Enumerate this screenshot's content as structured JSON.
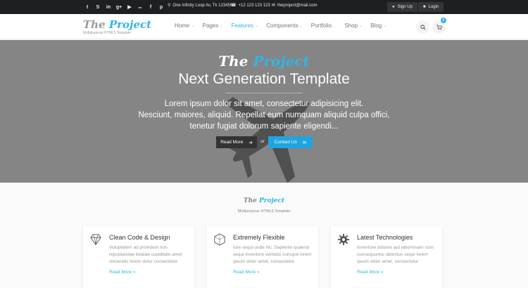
{
  "topbar": {
    "social_icons": [
      {
        "name": "twitter-icon",
        "glyph": "t"
      },
      {
        "name": "skype-icon",
        "glyph": "S"
      },
      {
        "name": "linkedin-icon",
        "glyph": "in"
      },
      {
        "name": "google-plus-icon",
        "glyph": "g+"
      },
      {
        "name": "youtube-icon",
        "glyph": "▶"
      },
      {
        "name": "flickr-icon",
        "glyph": "●●"
      },
      {
        "name": "facebook-icon",
        "glyph": "f"
      },
      {
        "name": "pinterest-icon",
        "glyph": "p"
      }
    ],
    "address": "One Infinity Loop Av, Tk 123456",
    "phone": "+12 123 123 123",
    "email": "theproject@mail.com",
    "signup_label": "Sign Up",
    "login_label": "Login"
  },
  "header": {
    "logo_the": "The",
    "logo_project": "Project",
    "tagline": "Multipurpose HTML5 Template",
    "nav": [
      {
        "label": "Home",
        "active": false
      },
      {
        "label": "Pages",
        "active": false
      },
      {
        "label": "Features",
        "active": true
      },
      {
        "label": "Components",
        "active": false
      },
      {
        "label": "Portfolio",
        "active": false
      },
      {
        "label": "Shop",
        "active": false
      },
      {
        "label": "Blog",
        "active": false
      }
    ],
    "cart_count": "0"
  },
  "hero": {
    "logo_the": "The",
    "logo_project": "Project",
    "title": "Next Generation Template",
    "text_lines": [
      "Lorem ipsum dolor sit amet, consectetur adipisicing elit.",
      "Nesciunt, maiores, aliquid. Repellat eum numquam aliquid culpa offici,",
      "tenetur fugiat dolorum sapiente eligendi..."
    ],
    "read_more_label": "Read More",
    "or_label": "or",
    "contact_label": "Contact Us"
  },
  "section": {
    "logo_the": "The",
    "logo_project": "Project",
    "tagline": "Multipurpose HTML5 Template",
    "cards": [
      {
        "icon": "diamond-icon",
        "title": "Clean Code & Design",
        "text": "Voluptatem ad provident non repudiandae beatae cupiditate amet reiciendis lorem dolor consectetur.",
        "link": "Read More »"
      },
      {
        "icon": "hexagon-icon",
        "title": "Extremely Flexible",
        "text": "Iure sequi unde hic. Sapiente quaerat sequi inventore veritatis cumque lorem ipsum dolor amet, consectetur.",
        "link": "Read More »"
      },
      {
        "icon": "cog-icon",
        "title": "Latest Technologies",
        "text": "Inventore dolores aut laboriosam cum consequuntur delectus sequi lorem ipsum dolor amet, consectetur.",
        "link": "Read More »"
      }
    ]
  },
  "colors": {
    "accent": "#33b5e5",
    "topbar_bg": "#1d1f20",
    "hero_bg": "#858585"
  }
}
